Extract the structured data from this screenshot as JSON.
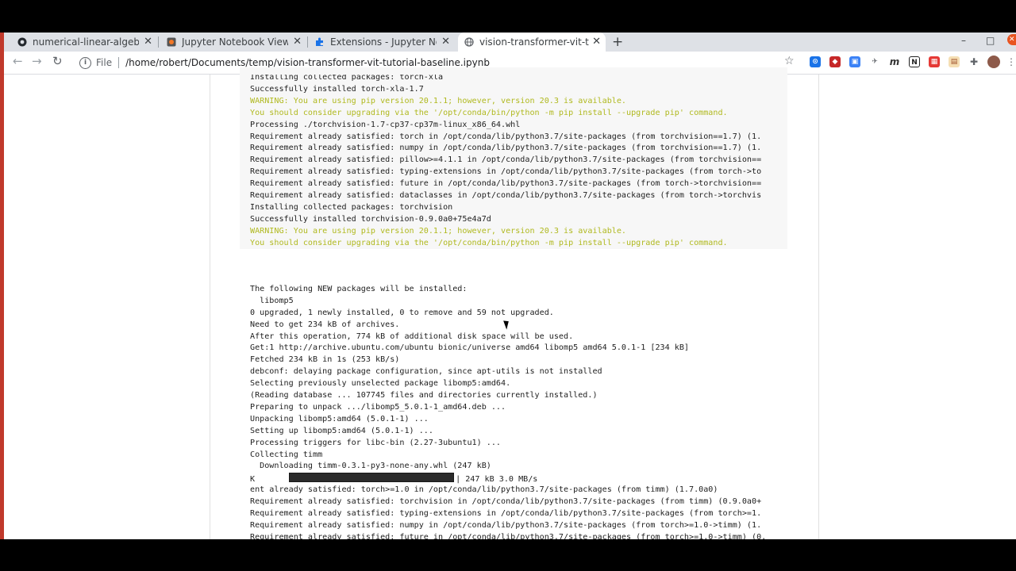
{
  "tabs": [
    {
      "title": "numerical-linear-algebra/",
      "icon": "github-icon"
    },
    {
      "title": "Jupyter Notebook Viewer",
      "icon": "jupyter-icon"
    },
    {
      "title": "Extensions - Jupyter Not",
      "icon": "puzzle-icon"
    },
    {
      "title": "vision-transformer-vit-tut",
      "icon": "globe-icon"
    }
  ],
  "toolbar": {
    "file_label": "File",
    "url": "/home/robert/Documents/temp/vision-transformer-vit-tutorial-baseline.ipynb"
  },
  "output_top": [
    {
      "text": "Installing collected packages: torch-xla",
      "warn": false
    },
    {
      "text": "Successfully installed torch-xla-1.7",
      "warn": false
    },
    {
      "text": "WARNING: You are using pip version 20.1.1; however, version 20.3 is available.",
      "warn": true
    },
    {
      "text": "You should consider upgrading via the '/opt/conda/bin/python -m pip install --upgrade pip' command.",
      "warn": true
    },
    {
      "text": "Processing ./torchvision-1.7-cp37-cp37m-linux_x86_64.whl",
      "warn": false
    },
    {
      "text": "Requirement already satisfied: torch in /opt/conda/lib/python3.7/site-packages (from torchvision==1.7) (1.",
      "warn": false
    },
    {
      "text": "Requirement already satisfied: numpy in /opt/conda/lib/python3.7/site-packages (from torchvision==1.7) (1.",
      "warn": false
    },
    {
      "text": "Requirement already satisfied: pillow>=4.1.1 in /opt/conda/lib/python3.7/site-packages (from torchvision==",
      "warn": false
    },
    {
      "text": "Requirement already satisfied: typing-extensions in /opt/conda/lib/python3.7/site-packages (from torch->to",
      "warn": false
    },
    {
      "text": "Requirement already satisfied: future in /opt/conda/lib/python3.7/site-packages (from torch->torchvision==",
      "warn": false
    },
    {
      "text": "Requirement already satisfied: dataclasses in /opt/conda/lib/python3.7/site-packages (from torch->torchvis",
      "warn": false
    },
    {
      "text": "Installing collected packages: torchvision",
      "warn": false
    },
    {
      "text": "Successfully installed torchvision-0.9.0a0+75e4a7d",
      "warn": false
    },
    {
      "text": "WARNING: You are using pip version 20.1.1; however, version 20.3 is available.",
      "warn": true
    },
    {
      "text": "You should consider upgrading via the '/opt/conda/bin/python -m pip install --upgrade pip' command.",
      "warn": true
    }
  ],
  "output_bottom": [
    "The following NEW packages will be installed:",
    "  libomp5",
    "0 upgraded, 1 newly installed, 0 to remove and 59 not upgraded.",
    "Need to get 234 kB of archives.",
    "After this operation, 774 kB of additional disk space will be used.",
    "Get:1 http://archive.ubuntu.com/ubuntu bionic/universe amd64 libomp5 amd64 5.0.1-1 [234 kB]",
    "Fetched 234 kB in 1s (253 kB/s)",
    "debconf: delaying package configuration, since apt-utils is not installed",
    "Selecting previously unselected package libomp5:amd64.",
    "(Reading database ... 107745 files and directories currently installed.)",
    "Preparing to unpack .../libomp5_5.0.1-1_amd64.deb ...",
    "Unpacking libomp5:amd64 (5.0.1-1) ...",
    "Setting up libomp5:amd64 (5.0.1-1) ...",
    "Processing triggers for libc-bin (2.27-3ubuntu1) ...",
    "Collecting timm",
    "  Downloading timm-0.3.1-py3-none-any.whl (247 kB)"
  ],
  "progress": {
    "prefix": "K",
    "suffix": "| 247 kB 3.0 MB/s",
    "fraction": 1.0
  },
  "output_tail": [
    "ent already satisfied: torch>=1.0 in /opt/conda/lib/python3.7/site-packages (from timm) (1.7.0a0)",
    "Requirement already satisfied: torchvision in /opt/conda/lib/python3.7/site-packages (from timm) (0.9.0a0+",
    "Requirement already satisfied: typing-extensions in /opt/conda/lib/python3.7/site-packages (from torch>=1.",
    "Requirement already satisfied: numpy in /opt/conda/lib/python3.7/site-packages (from torch>=1.0->timm) (1.",
    "Requirement already satisfied: future in /opt/conda/lib/python3.7/site-packages (from torch>=1.0->timm) (0."
  ]
}
